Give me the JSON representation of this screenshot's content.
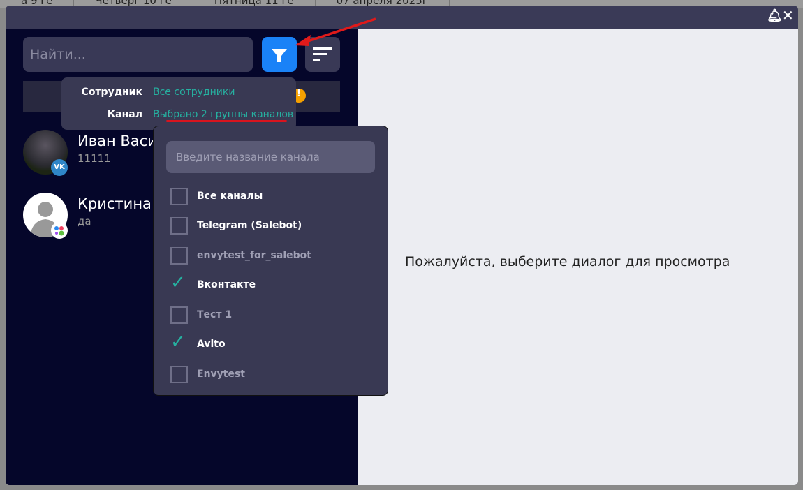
{
  "background_tabs": [
    "а 9 ге",
    "Четверг 10 ге",
    "Пятница 11 ге",
    "07 апреля 2025г"
  ],
  "search": {
    "placeholder": "Найти..."
  },
  "filter_popup": {
    "employee_label": "Сотрудник",
    "employee_value": "Все сотрудники",
    "channel_label": "Канал",
    "channel_value": "Выбрано 2 группы каналов"
  },
  "channel_dropdown": {
    "placeholder": "Введите название канала",
    "options": [
      {
        "label": "Все каналы",
        "checked": false
      },
      {
        "label": "Telegram (Salebot)",
        "checked": false
      },
      {
        "label": "envytest_for_salebot",
        "checked": false
      },
      {
        "label": "Вконтакте",
        "checked": true
      },
      {
        "label": "Тест 1",
        "checked": false
      },
      {
        "label": "Avito",
        "checked": true
      },
      {
        "label": "Envytest",
        "checked": false
      }
    ]
  },
  "chats": [
    {
      "name": "Иван Васи",
      "message": "11111",
      "channel": "vk"
    },
    {
      "name": "Кристина",
      "message": "да",
      "channel": "multi"
    }
  ],
  "empty_state": "Пожалуйста, выберите диалог для просмотра",
  "warning_badge": "!",
  "colors": {
    "accent": "#1a82f7",
    "teal": "#26b0a0",
    "annotation": "#d8141e"
  }
}
